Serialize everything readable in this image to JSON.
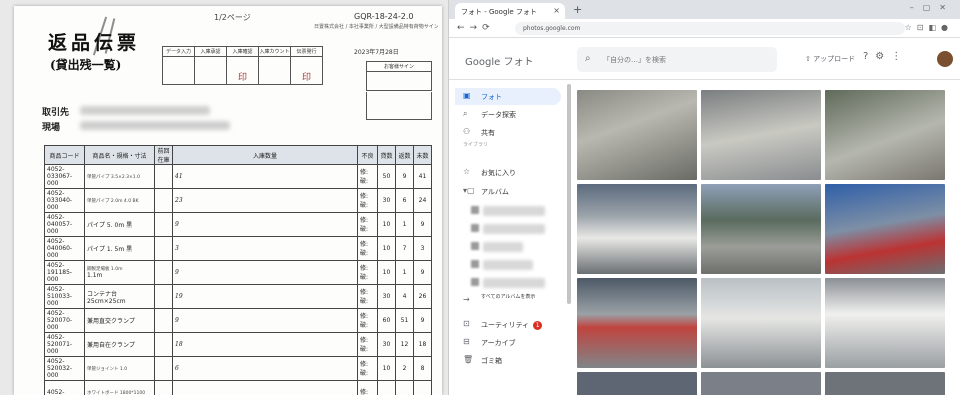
{
  "document": {
    "page": "1/2ページ",
    "doc_number": "GQR-18-24-2.0",
    "small_text": "日置株式会社 / 本社事業所 / 大型設備品特有荷物サイン記載",
    "title": "返品伝票",
    "subtitle": "(貸出残一覧)",
    "stamp_headers": [
      "データ入力",
      "入庫承認",
      "入庫確認",
      "入庫カウント",
      "伝票発行"
    ],
    "stamp_values": [
      "",
      "",
      "印",
      "",
      "印"
    ],
    "date": "2023年7月28日",
    "sign_label": "お客様サイン",
    "client_label": "取引先",
    "site_label": "現場",
    "columns": [
      "商品コード",
      "商品名・規格・寸法",
      "前回在庫",
      "入庫数量",
      "不良",
      "貸数",
      "返数",
      "未数"
    ],
    "rows": [
      {
        "code": "4052-033067-000",
        "name": "",
        "name_small": "単管パイプ 3.5×2.3×1.0",
        "hand": "41",
        "defect": "修: 破:",
        "loan": "50",
        "ret": "9",
        "rem": "41"
      },
      {
        "code": "4052-033040-000",
        "name": "",
        "name_small": "単管パイプ 2.0m 4.0 BK",
        "hand": "23",
        "defect": "修: 破:",
        "loan": "30",
        "ret": "6",
        "rem": "24"
      },
      {
        "code": "4052-040057-000",
        "name": "パイプ 5. 0m 黒",
        "name_small": "",
        "hand": "9",
        "defect": "修: 破:",
        "loan": "10",
        "ret": "1",
        "rem": "9"
      },
      {
        "code": "4052-040060-000",
        "name": "パイプ 1. 5m 黒",
        "name_small": "",
        "hand": "3",
        "defect": "修: 破:",
        "loan": "10",
        "ret": "7",
        "rem": "3"
      },
      {
        "code": "4052-191185-000",
        "name": "1.1m",
        "name_small": "鋼製足場板 1.0m",
        "hand": "9",
        "defect": "修: 破:",
        "loan": "10",
        "ret": "1",
        "rem": "9"
      },
      {
        "code": "4052-510033-000",
        "name": "コンテナ台 25cm×25cm",
        "name_small": "",
        "hand": "19",
        "defect": "修: 破:",
        "loan": "30",
        "ret": "4",
        "rem": "26"
      },
      {
        "code": "4052-520070-000",
        "name": "兼用直交クランプ",
        "name_small": "",
        "hand": "9",
        "defect": "修: 破:",
        "loan": "60",
        "ret": "51",
        "rem": "9"
      },
      {
        "code": "4052-520071-000",
        "name": "兼用自在クランプ",
        "name_small": "",
        "hand": "18",
        "defect": "修: 破:",
        "loan": "30",
        "ret": "12",
        "rem": "18"
      },
      {
        "code": "4052-520032-000",
        "name": "",
        "name_small": "単管ジョイント 1.0",
        "hand": "6",
        "defect": "修: 破:",
        "loan": "10",
        "ret": "2",
        "rem": "8"
      },
      {
        "code": "4052-",
        "name": "",
        "name_small": "ホワイトボード 1800*1100",
        "hand": "",
        "defect": "修:",
        "loan": "",
        "ret": "",
        "rem": ""
      }
    ]
  },
  "browser": {
    "tab_title": "フォト - Google フォト",
    "url": "photos.google.com",
    "app_name": "Google フォト",
    "search_placeholder": "「自分の…」を検索",
    "upload_label": "アップロード",
    "sidebar": {
      "items": [
        {
          "label": "フォト",
          "icon": "photo-icon",
          "active": true
        },
        {
          "label": "データ探索",
          "icon": "search-icon",
          "active": false
        },
        {
          "label": "共有",
          "icon": "share-icon",
          "active": false
        }
      ],
      "section_label": "ライブラリ",
      "library": [
        {
          "label": "お気に入り",
          "icon": "star-icon"
        },
        {
          "label": "アルバム",
          "icon": "album-icon"
        }
      ],
      "show_all": "すべてのアルバムを表示",
      "bottom": [
        {
          "label": "ユーティリティ",
          "icon": "utility-icon",
          "badge": "1"
        },
        {
          "label": "アーカイブ",
          "icon": "archive-icon"
        },
        {
          "label": "ゴミ箱",
          "icon": "trash-icon"
        }
      ]
    },
    "accent": "#1967d2"
  }
}
